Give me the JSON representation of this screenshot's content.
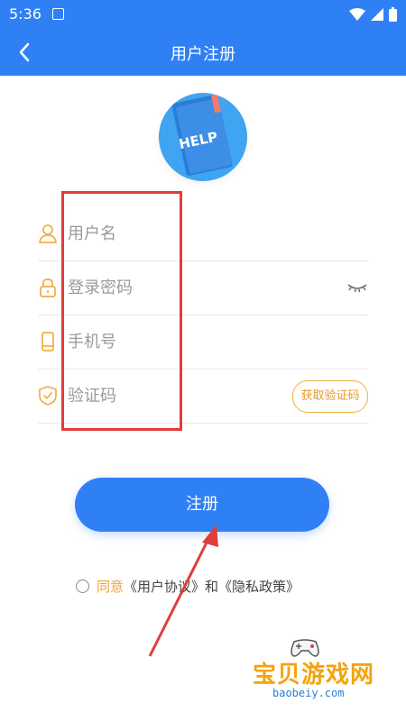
{
  "status_bar": {
    "time": "5:36"
  },
  "nav": {
    "title": "用户注册"
  },
  "logo": {
    "text": "HELP"
  },
  "form": {
    "username_placeholder": "用户名",
    "password_placeholder": "登录密码",
    "phone_placeholder": "手机号",
    "code_placeholder": "验证码",
    "get_code_label": "获取验证码"
  },
  "register_label": "注册",
  "agreement": {
    "agree": "同意",
    "user_agreement": "《用户协议》",
    "and": "和",
    "privacy_policy": "《隐私政策》"
  },
  "watermark": {
    "name": "宝贝游戏网",
    "url": "baobeiy.com"
  },
  "colors": {
    "primary": "#2f80f4",
    "accent": "#f0a33a",
    "annotation": "#e23c3c"
  }
}
